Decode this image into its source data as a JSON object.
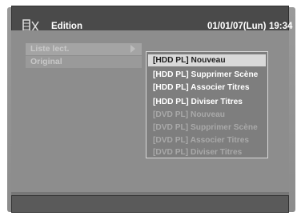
{
  "header": {
    "title": "Edition",
    "date": "01/01/07(Lun)",
    "time": "19:34",
    "icon": "edit-icon"
  },
  "left_menu": {
    "items": [
      {
        "label": "Liste lect."
      },
      {
        "label": "Original"
      }
    ],
    "arrow_icon": "chevron-right-icon"
  },
  "submenu": {
    "items": [
      {
        "label": "[HDD PL] Nouveau",
        "state": "selected"
      },
      {
        "label": "[HDD PL] Supprimer Scène",
        "state": "enabled"
      },
      {
        "label": "[HDD PL] Associer Titres",
        "state": "enabled"
      },
      {
        "label": "[HDD PL] Diviser Titres",
        "state": "enabled"
      },
      {
        "label": "[DVD PL] Nouveau",
        "state": "disabled"
      },
      {
        "label": "[DVD PL] Supprimer Scène",
        "state": "disabled"
      },
      {
        "label": "[DVD PL] Associer Titres",
        "state": "disabled"
      },
      {
        "label": "[DVD PL] Diviser Titres",
        "state": "disabled"
      }
    ]
  },
  "colors": {
    "panel": "#8d8d8d",
    "titlebar": "#4a4a4a",
    "highlight": "#d9d9d9",
    "disabled_text": "#a9a9a9"
  }
}
